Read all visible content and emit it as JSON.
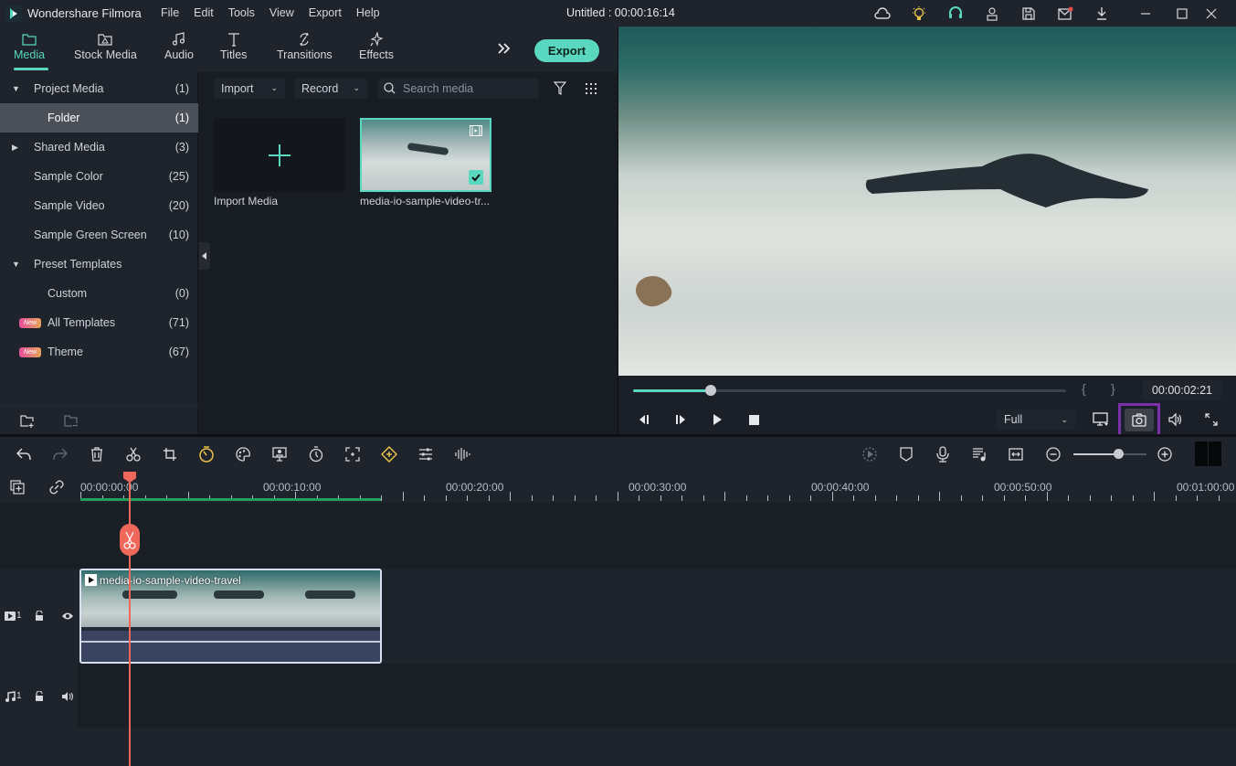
{
  "app": {
    "name": "Wondershare Filmora",
    "document_title": "Untitled : 00:00:16:14",
    "menu": [
      "File",
      "Edit",
      "Tools",
      "View",
      "Export",
      "Help"
    ],
    "title_icons": [
      "cloud-icon",
      "lightbulb-icon",
      "headset-icon",
      "account-icon",
      "save-icon",
      "mail-icon",
      "download-icon",
      "minimize-icon",
      "maximize-icon",
      "close-icon"
    ],
    "accent_color": "#5ad8bf",
    "highlight_color": "#7b2fa8"
  },
  "tabs": [
    {
      "label": "Media",
      "icon": "folder-icon",
      "active": true
    },
    {
      "label": "Stock Media",
      "icon": "stock-media-icon",
      "active": false
    },
    {
      "label": "Audio",
      "icon": "music-note-icon",
      "active": false
    },
    {
      "label": "Titles",
      "icon": "text-icon",
      "active": false
    },
    {
      "label": "Transitions",
      "icon": "transitions-icon",
      "active": false
    },
    {
      "label": "Effects",
      "icon": "effects-icon",
      "active": false
    }
  ],
  "export_label": "Export",
  "sidebar": {
    "items": [
      {
        "label": "Project Media",
        "count": "(1)",
        "caret": "down"
      },
      {
        "label": "Folder",
        "count": "(1)",
        "selected": true
      },
      {
        "label": "Shared Media",
        "count": "(3)",
        "caret": "right"
      },
      {
        "label": "Sample Color",
        "count": "(25)"
      },
      {
        "label": "Sample Video",
        "count": "(20)"
      },
      {
        "label": "Sample Green Screen",
        "count": "(10)"
      },
      {
        "label": "Preset Templates",
        "count": "",
        "caret": "down"
      },
      {
        "label": "Custom",
        "count": "(0)"
      },
      {
        "label": "All Templates",
        "count": "(71)",
        "badge": "New"
      },
      {
        "label": "Theme",
        "count": "(67)",
        "badge": "New"
      }
    ]
  },
  "media": {
    "import_label": "Import",
    "record_label": "Record",
    "search_placeholder": "Search media",
    "tiles": [
      {
        "label": "Import Media"
      },
      {
        "label": "media-io-sample-video-tr..."
      }
    ]
  },
  "preview": {
    "timecode": "00:00:02:21",
    "progress": 0.18,
    "quality": "Full"
  },
  "timeline": {
    "ruler_labels": [
      "00:00:00:00",
      "00:00:10:00",
      "00:00:20:00",
      "00:00:30:00",
      "00:00:40:00",
      "00:00:50:00",
      "00:01:00:00"
    ],
    "zoom_level": 0.61,
    "video_track": {
      "label": "1",
      "clip_name": "media-io-sample-video-travel"
    },
    "audio_track": {
      "label": "1"
    }
  }
}
